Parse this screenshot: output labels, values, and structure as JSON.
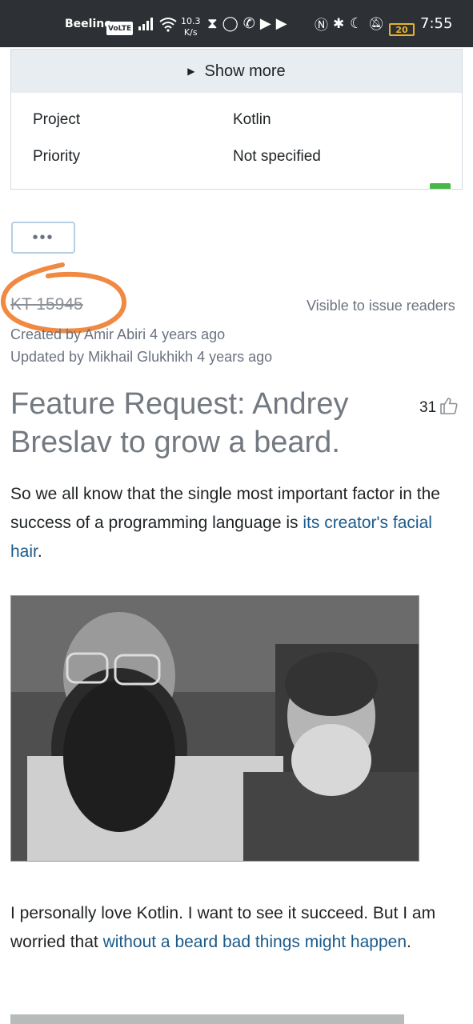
{
  "status_bar": {
    "carrier": "Beeline",
    "volte": "VoLTE",
    "speed_value": "10.3",
    "speed_unit": "K/s",
    "battery": "20",
    "time": "7:55"
  },
  "details": {
    "show_more": "Show more",
    "fields": [
      {
        "label": "Project",
        "value": "Kotlin"
      },
      {
        "label": "Priority",
        "value": "Not specified"
      }
    ]
  },
  "more_button": "•••",
  "issue": {
    "id": "KT 15945",
    "visibility": "Visible to issue readers",
    "created": "Created by Amir Abiri 4 years ago",
    "updated": "Updated by Mikhail Glukhikh 4 years ago",
    "title": "Feature Request: Andrey Breslav to grow a beard.",
    "votes": "31"
  },
  "body": {
    "p1_text": "So we all know that the single most important factor in the success of a programming language is ",
    "p1_link": "its creator's facial hair",
    "p1_end": ".",
    "p2_text": "I personally love Kotlin. I want to see it succeed. But I am worried that ",
    "p2_link": "without a beard bad things might happen",
    "p2_end": "."
  },
  "colors": {
    "link": "#1a5a8a",
    "annotation": "#f08a43",
    "header_bg": "#e8edf2"
  }
}
